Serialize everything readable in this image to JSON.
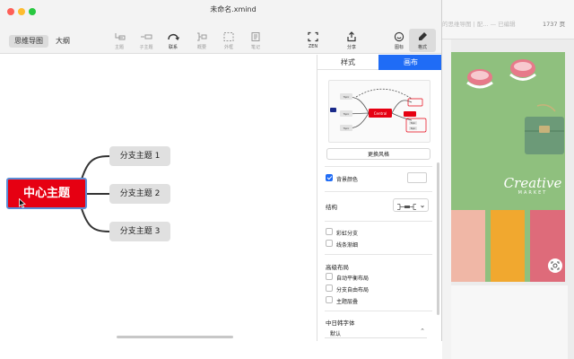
{
  "window": {
    "doc_title": "未命名.xmind",
    "view_tabs": [
      "思维导图",
      "大纲"
    ]
  },
  "toolbar": {
    "items": [
      {
        "label": "主题",
        "icon": "topic-icon"
      },
      {
        "label": "子主题",
        "icon": "subtopic-icon"
      },
      {
        "label": "联系",
        "icon": "relationship-icon"
      },
      {
        "label": "概要",
        "icon": "summary-icon"
      },
      {
        "label": "外框",
        "icon": "boundary-icon"
      },
      {
        "label": "笔记",
        "icon": "note-icon"
      },
      {
        "label": "ZEN",
        "icon": "zen-icon"
      },
      {
        "label": "分享",
        "icon": "share-icon"
      },
      {
        "label": "图标",
        "icon": "emoji-icon"
      },
      {
        "label": "格式",
        "icon": "format-icon"
      }
    ]
  },
  "mindmap": {
    "central": "中心主题",
    "branches": [
      "分支主题 1",
      "分支主题 2",
      "分支主题 3"
    ]
  },
  "panel": {
    "tabs": [
      "样式",
      "画布"
    ],
    "active_tab": "画布",
    "preview": {
      "central_label": "Central",
      "topic_label": "Topic"
    },
    "change_style_button": "更换风格",
    "background_color_label": "背景颜色",
    "background_color_checked": true,
    "structure_label": "结构",
    "rainbow_branch_label": "彩虹分支",
    "tapered_lines_label": "线条渐细",
    "advanced_layout_label": "高级布局",
    "auto_balance_label": "自动平衡布局",
    "free_branch_label": "分支自由布局",
    "topic_overlap_label": "主题层叠",
    "cjk_font_label": "中日韩字体",
    "cjk_font_value": "默认"
  },
  "background_window": {
    "title": "的思维导图 | 配... — 已编辑",
    "time": "1737 页",
    "watermark_line1": "Creative",
    "watermark_line2": "MARKET"
  },
  "colors": {
    "accent_blue": "#1f6cf6",
    "central_red": "#e60012",
    "branch_gray": "#e0e0e0",
    "photo_green": "#8fc07e"
  }
}
